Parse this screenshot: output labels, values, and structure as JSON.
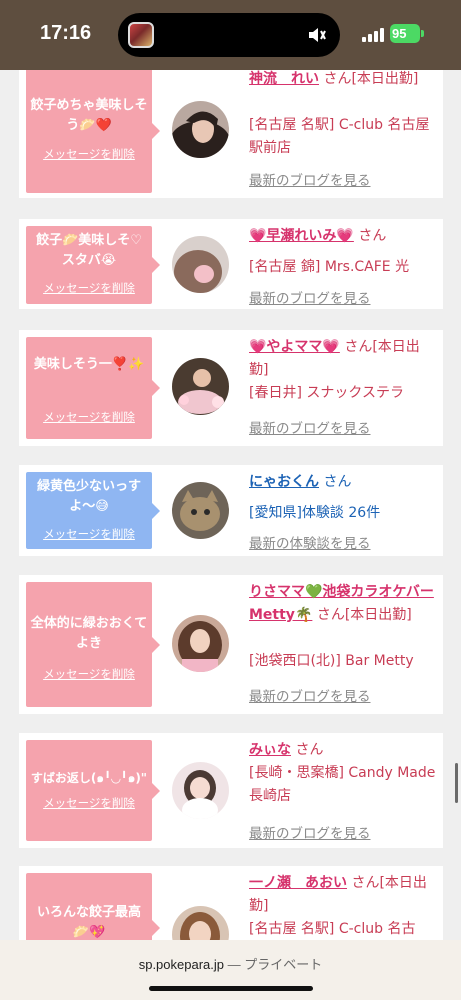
{
  "status": {
    "time": "17:16",
    "battery": "95"
  },
  "cards": [
    {
      "message": "餃子めちゃ美味しそう🥟❤️",
      "delete_label": "メッセージを削除",
      "name": "神流　れい",
      "honorific": "さん",
      "badge": "[本日出勤]",
      "location": "[名古屋 名駅] C-club 名古屋駅前店",
      "link": "最新のブログを見る"
    },
    {
      "message": "餃子🥟美味しそ♡スタバ😭",
      "delete_label": "メッセージを削除",
      "name": "💗早瀬れいみ💗",
      "honorific": "さん",
      "badge": "",
      "location": "[名古屋 錦] Mrs.CAFE 光",
      "link": "最新のブログを見る"
    },
    {
      "message": "美味しそう一❣️✨",
      "delete_label": "メッセージを削除",
      "name": "💗やよママ💗",
      "honorific": "さん",
      "badge": "[本日出勤]",
      "location": "[春日井] スナックステラ",
      "link": "最新のブログを見る"
    },
    {
      "message": "緑黄色少ないっすよ〜😅",
      "delete_label": "メッセージを削除",
      "name": "にゃおくん",
      "honorific": "さん",
      "badge": "",
      "location": "[愛知県]体験談 26件",
      "link": "最新の体験談を見る"
    },
    {
      "message": "全体的に緑おおくてよき",
      "delete_label": "メッセージを削除",
      "name": "りさママ💚池袋カラオケバーMetty🌴",
      "honorific": "さん",
      "badge": "[本日出勤]",
      "location": "[池袋西口(北)] Bar Metty",
      "link": "最新のブログを見る"
    },
    {
      "message": "すばお返し(๑╹◡╹๑)\"",
      "delete_label": "メッセージを削除",
      "name": "みぃな",
      "honorific": "さん",
      "badge": "",
      "location": "[長崎・思案橋] Candy Made 長崎店",
      "link": "最新のブログを見る"
    },
    {
      "message": "いろんな餃子最高🥟💖",
      "delete_label": "メッセージを削除",
      "name": "一ノ瀬　あおい",
      "honorific": "さん",
      "badge": "[本日出勤]",
      "location": "[名古屋 名駅] C-club 名古",
      "link": ""
    }
  ],
  "browser": {
    "domain": "sp.pokepara.jp",
    "separator": "—",
    "mode": "プライベート"
  },
  "colors": {
    "status_bar": "#5e4e3f",
    "bubble_pink": "#f5a3ad",
    "bubble_blue": "#8fb6f2",
    "name_pink": "#d6336c",
    "name_blue": "#1d63b5"
  }
}
